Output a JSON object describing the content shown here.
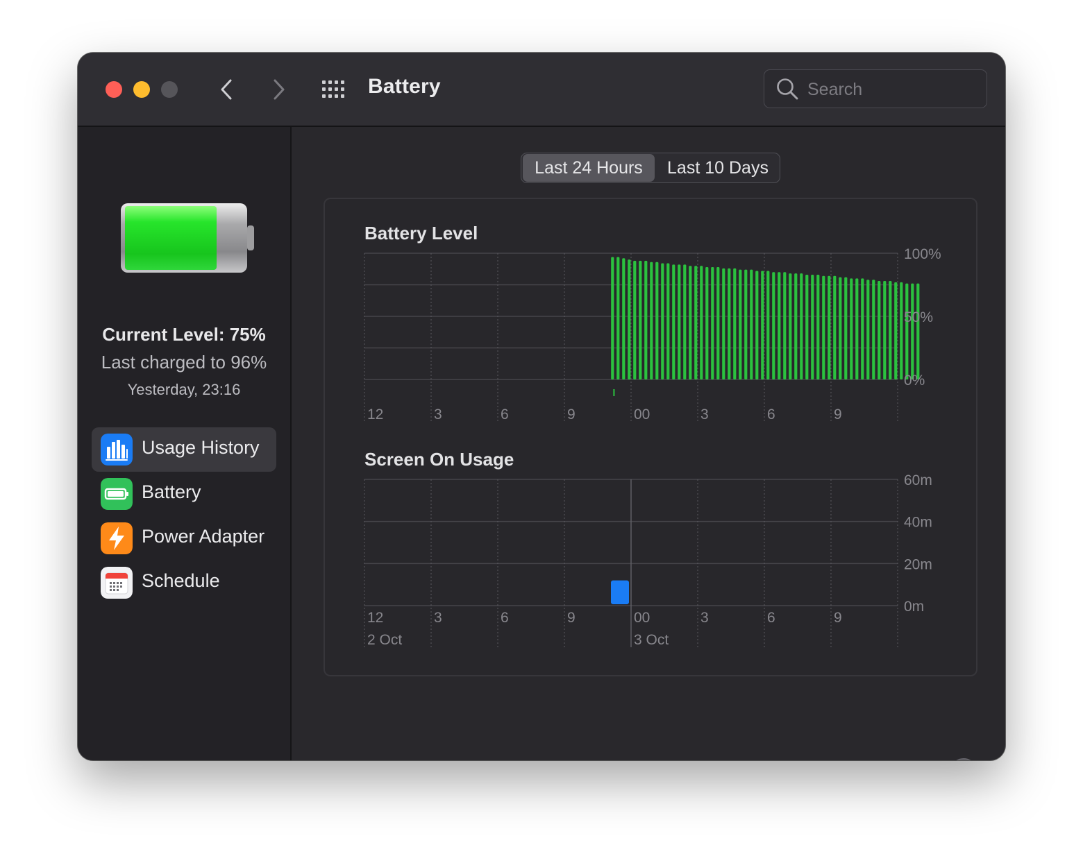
{
  "window": {
    "title": "Battery",
    "search": {
      "placeholder": "Search",
      "value": ""
    }
  },
  "sidebar": {
    "current_level": "Current Level: 75%",
    "last_charged": "Last charged to 96%",
    "last_charged_time": "Yesterday, 23:16",
    "items": [
      {
        "label": "Usage History",
        "icon": "usage-history-icon",
        "color": "#1a7cf5",
        "active": true
      },
      {
        "label": "Battery",
        "icon": "battery-icon",
        "color": "#31c15a",
        "active": false
      },
      {
        "label": "Power Adapter",
        "icon": "lightning-icon",
        "color": "#fe8a19",
        "active": false
      },
      {
        "label": "Schedule",
        "icon": "calendar-icon",
        "color": "#f2f2f4",
        "active": false
      }
    ]
  },
  "tabs": {
    "last_24": "Last 24 Hours",
    "last_10": "Last 10 Days",
    "selected": "Last 24 Hours"
  },
  "chart_data": [
    {
      "type": "bar",
      "title": "Battery Level",
      "x_tick_labels": [
        "12",
        "3",
        "6",
        "9",
        "00",
        "3",
        "6",
        "9"
      ],
      "y_tick_labels": [
        "100%",
        "50%",
        "0%"
      ],
      "ylim": [
        0,
        100
      ],
      "bar_color": "#2bc23f",
      "start_hour_offset": 11.1,
      "bar_spacing_hours": 0.25,
      "values": [
        97,
        97,
        96,
        95,
        94,
        94,
        94,
        93,
        93,
        92,
        92,
        91,
        91,
        91,
        90,
        90,
        90,
        89,
        89,
        89,
        88,
        88,
        88,
        87,
        87,
        87,
        86,
        86,
        86,
        85,
        85,
        85,
        84,
        84,
        84,
        83,
        83,
        83,
        82,
        82,
        82,
        81,
        81,
        80,
        80,
        80,
        79,
        79,
        78,
        78,
        78,
        77,
        77,
        76,
        76,
        76
      ],
      "charging_marker_hour_offset": 11.2
    },
    {
      "type": "bar",
      "title": "Screen On Usage",
      "x_tick_labels": [
        "12",
        "3",
        "6",
        "9",
        "00",
        "3",
        "6",
        "9"
      ],
      "date_labels": [
        "2 Oct",
        "3 Oct"
      ],
      "y_tick_labels": [
        "60m",
        "40m",
        "20m",
        "0m"
      ],
      "ylim": [
        0,
        60
      ],
      "bar_color": "#1a7cf5",
      "bars": [
        {
          "hour_offset": 11,
          "minutes": 12
        }
      ]
    }
  ],
  "help": "?"
}
